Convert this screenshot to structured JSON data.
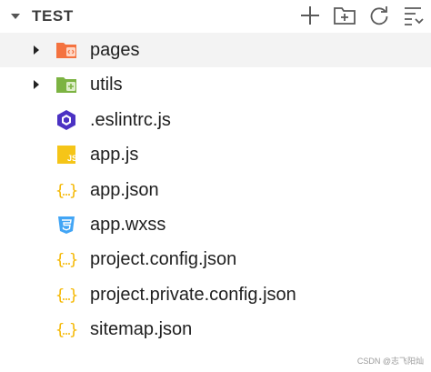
{
  "explorer": {
    "title": "TEST",
    "actions": [
      {
        "name": "new-file-icon"
      },
      {
        "name": "new-folder-icon"
      },
      {
        "name": "refresh-icon"
      },
      {
        "name": "collapse-all-icon"
      }
    ]
  },
  "tree": [
    {
      "label": "pages",
      "kind": "folder",
      "icon": "folder-pages-icon",
      "color": "#f4723f",
      "expandable": true,
      "selected": true
    },
    {
      "label": "utils",
      "kind": "folder",
      "icon": "folder-utils-icon",
      "color": "#7cb342",
      "expandable": true,
      "selected": false
    },
    {
      "label": ".eslintrc.js",
      "kind": "file",
      "icon": "eslint-icon",
      "color": "#4b32c3",
      "expandable": false,
      "selected": false
    },
    {
      "label": "app.js",
      "kind": "file",
      "icon": "js-file-icon",
      "color": "#f5c518",
      "expandable": false,
      "selected": false
    },
    {
      "label": "app.json",
      "kind": "file",
      "icon": "json-file-icon",
      "color": "#f5b700",
      "expandable": false,
      "selected": false
    },
    {
      "label": "app.wxss",
      "kind": "file",
      "icon": "css-file-icon",
      "color": "#42a5f5",
      "expandable": false,
      "selected": false
    },
    {
      "label": "project.config.json",
      "kind": "file",
      "icon": "json-file-icon",
      "color": "#f5b700",
      "expandable": false,
      "selected": false
    },
    {
      "label": "project.private.config.json",
      "kind": "file",
      "icon": "json-file-icon",
      "color": "#f5b700",
      "expandable": false,
      "selected": false
    },
    {
      "label": "sitemap.json",
      "kind": "file",
      "icon": "json-file-icon",
      "color": "#f5b700",
      "expandable": false,
      "selected": false
    }
  ],
  "watermark": "CSDN @志飞阳灿"
}
